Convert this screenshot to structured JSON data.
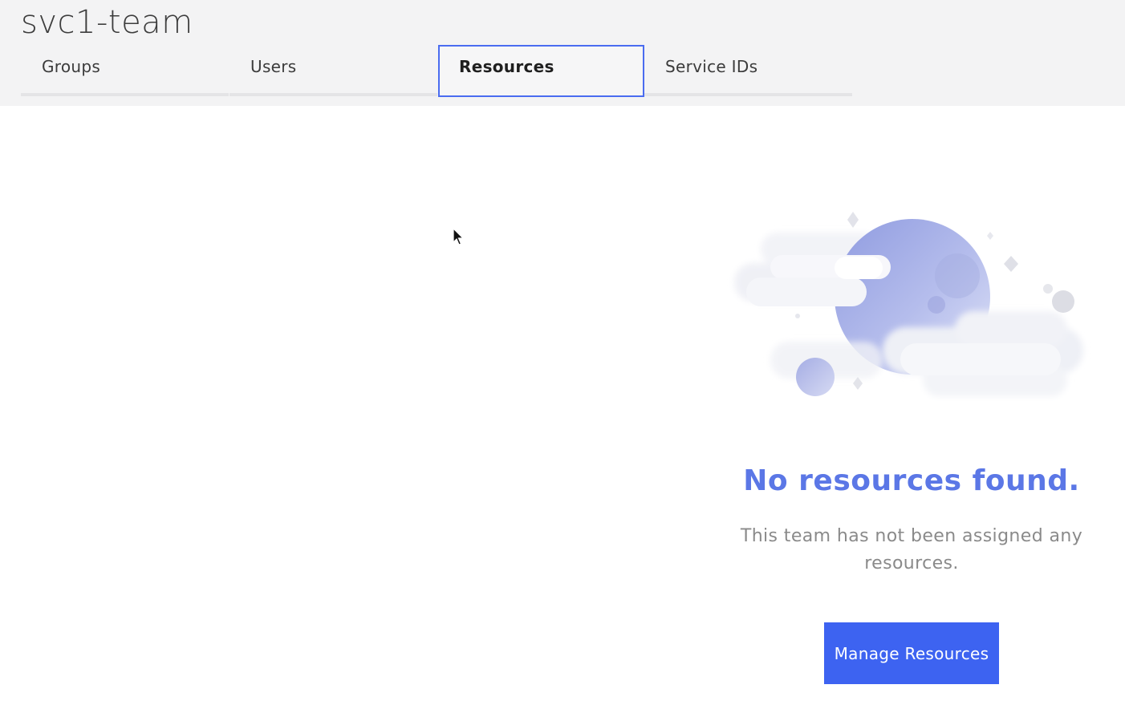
{
  "header": {
    "title": "svc1-team"
  },
  "tabs": [
    {
      "label": "Groups",
      "active": false
    },
    {
      "label": "Users",
      "active": false
    },
    {
      "label": "Resources",
      "active": true
    },
    {
      "label": "Service IDs",
      "active": false
    }
  ],
  "empty_state": {
    "illustration": "planet-clouds-illustration",
    "title": "No resources found.",
    "description": "This team has not been assigned any resources.",
    "button_label": "Manage Resources"
  },
  "colors": {
    "accent": "#3d63f1",
    "title_accent": "#5b77e6",
    "active_tab_border": "#4a6cf0",
    "header_bg": "#f3f3f4"
  }
}
